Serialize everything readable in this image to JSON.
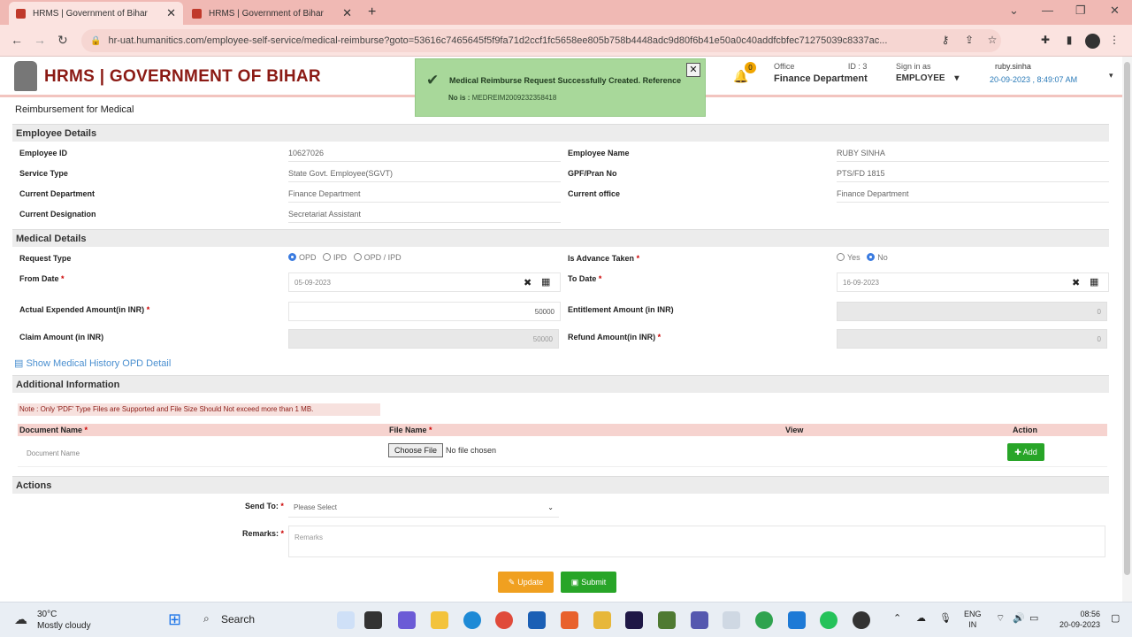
{
  "browser": {
    "tabs": [
      {
        "title": "HRMS | Government of Bihar",
        "active": true
      },
      {
        "title": "HRMS | Government of Bihar",
        "active": false
      }
    ],
    "url": "hr-uat.humanitics.com/employee-self-service/medical-reimburse?goto=53616c7465645f5f9fa71d2ccf1fc5658ee805b758b4448adc9d80f6b41e50a0c40addfcbfec71275039c8337ac..."
  },
  "header": {
    "brand": "HRMS | GOVERNMENT OF BIHAR",
    "notification_count": "0",
    "office_label": "Office",
    "office_id": "ID : 3",
    "office_name": "Finance Department",
    "sign_in_label": "Sign in as",
    "sign_in_role": "EMPLOYEE",
    "username": "ruby.sinha",
    "datetime": "20-09-2023 , 8:49:07 AM"
  },
  "toast": {
    "message": "Medical Reimburse Request Successfully Created. Reference",
    "ref_label": "No is :",
    "ref_value": "MEDREIM2009232358418"
  },
  "page_title": "Reimbursement for Medical",
  "employee": {
    "section": "Employee Details",
    "fields": [
      {
        "label": "Employee ID",
        "value": "10627026"
      },
      {
        "label": "Employee Name",
        "value": "RUBY SINHA"
      },
      {
        "label": "Service Type",
        "value": "State Govt. Employee(SGVT)"
      },
      {
        "label": "GPF/Pran No",
        "value": "PTS/FD 1815"
      },
      {
        "label": "Current Department",
        "value": "Finance Department"
      },
      {
        "label": "Current office",
        "value": "Finance Department"
      },
      {
        "label": "Current Designation",
        "value": "Secretariat Assistant"
      }
    ]
  },
  "medical": {
    "section": "Medical Details",
    "request_type_label": "Request Type",
    "request_types": [
      "OPD",
      "IPD",
      "OPD / IPD"
    ],
    "request_type_selected": "OPD",
    "advance_label": "Is Advance Taken",
    "advance_options": [
      "Yes",
      "No"
    ],
    "advance_selected": "No",
    "from_date_label": "From Date",
    "from_date": "05-09-2023",
    "to_date_label": "To Date",
    "to_date": "16-09-2023",
    "expended_label": "Actual Expended Amount(in INR)",
    "expended_value": "50000",
    "entitlement_label": "Entitlement Amount (in INR)",
    "entitlement_value": "0",
    "claim_label": "Claim Amount (in INR)",
    "claim_value": "50000",
    "refund_label": "Refund Amount(in INR)",
    "refund_value": "0"
  },
  "history_link": "Show Medical History OPD Detail",
  "additional": {
    "section": "Additional Information",
    "note": "Note : Only 'PDF' Type Files are Supported and File Size Should Not exceed more than 1 MB.",
    "columns": [
      "Document Name",
      "File Name",
      "View",
      "Action"
    ],
    "doc_placeholder": "Document Name",
    "choose_file": "Choose File",
    "no_file": "No file chosen",
    "add_label": "Add"
  },
  "actions": {
    "section": "Actions",
    "send_to_label": "Send To:",
    "send_to_value": "Please Select",
    "remarks_label": "Remarks:",
    "remarks_placeholder": "Remarks",
    "update_label": "Update",
    "submit_label": "Submit"
  },
  "taskbar": {
    "temp": "30°C",
    "weather": "Mostly cloudy",
    "search": "Search",
    "lang1": "ENG",
    "lang2": "IN",
    "time": "08:56",
    "date": "20-09-2023"
  },
  "colors": {
    "brand": "#8b1a14",
    "toast_bg": "#a8d89a",
    "submit": "#28a528",
    "update": "#f0a020"
  }
}
